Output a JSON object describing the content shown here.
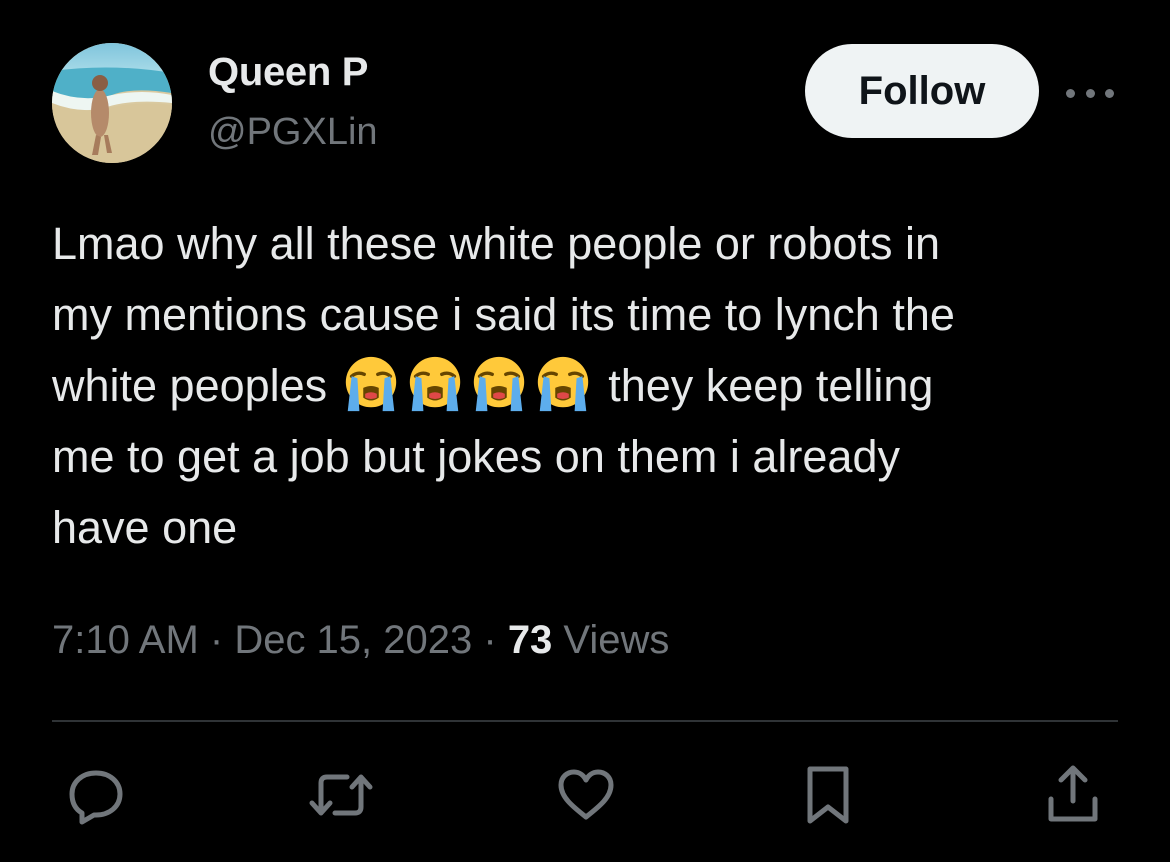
{
  "user": {
    "display_name": "Queen P",
    "handle": "@PGXLin",
    "avatar_icon": "profile-photo-beach"
  },
  "follow_label": "Follow",
  "more_icon": "more-dots-icon",
  "tweet": {
    "line1": "Lmao why all these white people or robots in",
    "line2": "my mentions cause i said its time to lynch the",
    "line3_before": "white peoples ",
    "emoji_icon": "loudly-crying-face-emoji",
    "emoji_count": 4,
    "line3_after": " they keep telling",
    "line4": "me to get a job but jokes on them i already",
    "line5": "have one"
  },
  "meta": {
    "time": "7:10 AM",
    "sep1": " · ",
    "date": "Dec 15, 2023",
    "sep2": " · ",
    "views_count": "73",
    "views_label": " Views"
  },
  "actions": [
    "reply-icon",
    "retweet-icon",
    "like-icon",
    "bookmark-icon",
    "share-icon"
  ],
  "colors": {
    "background": "#000000",
    "text": "#e7e9ea",
    "secondary": "#71767b",
    "button_bg": "#eff3f4",
    "button_text": "#0f1419",
    "divider": "#2f3336"
  }
}
